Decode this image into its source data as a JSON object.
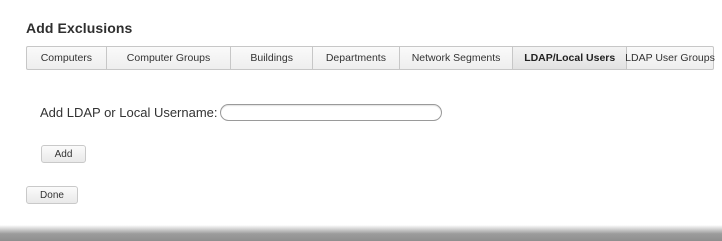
{
  "page": {
    "title": "Add Exclusions"
  },
  "tabs": [
    {
      "label": "Computers"
    },
    {
      "label": "Computer Groups"
    },
    {
      "label": "Buildings"
    },
    {
      "label": "Departments"
    },
    {
      "label": "Network Segments"
    },
    {
      "label": "LDAP/Local Users",
      "active": true
    },
    {
      "label": "LDAP User Groups"
    }
  ],
  "form": {
    "username_label": "Add LDAP or Local Username:",
    "username_value": "",
    "username_placeholder": "",
    "add_label": "Add",
    "done_label": "Done"
  }
}
